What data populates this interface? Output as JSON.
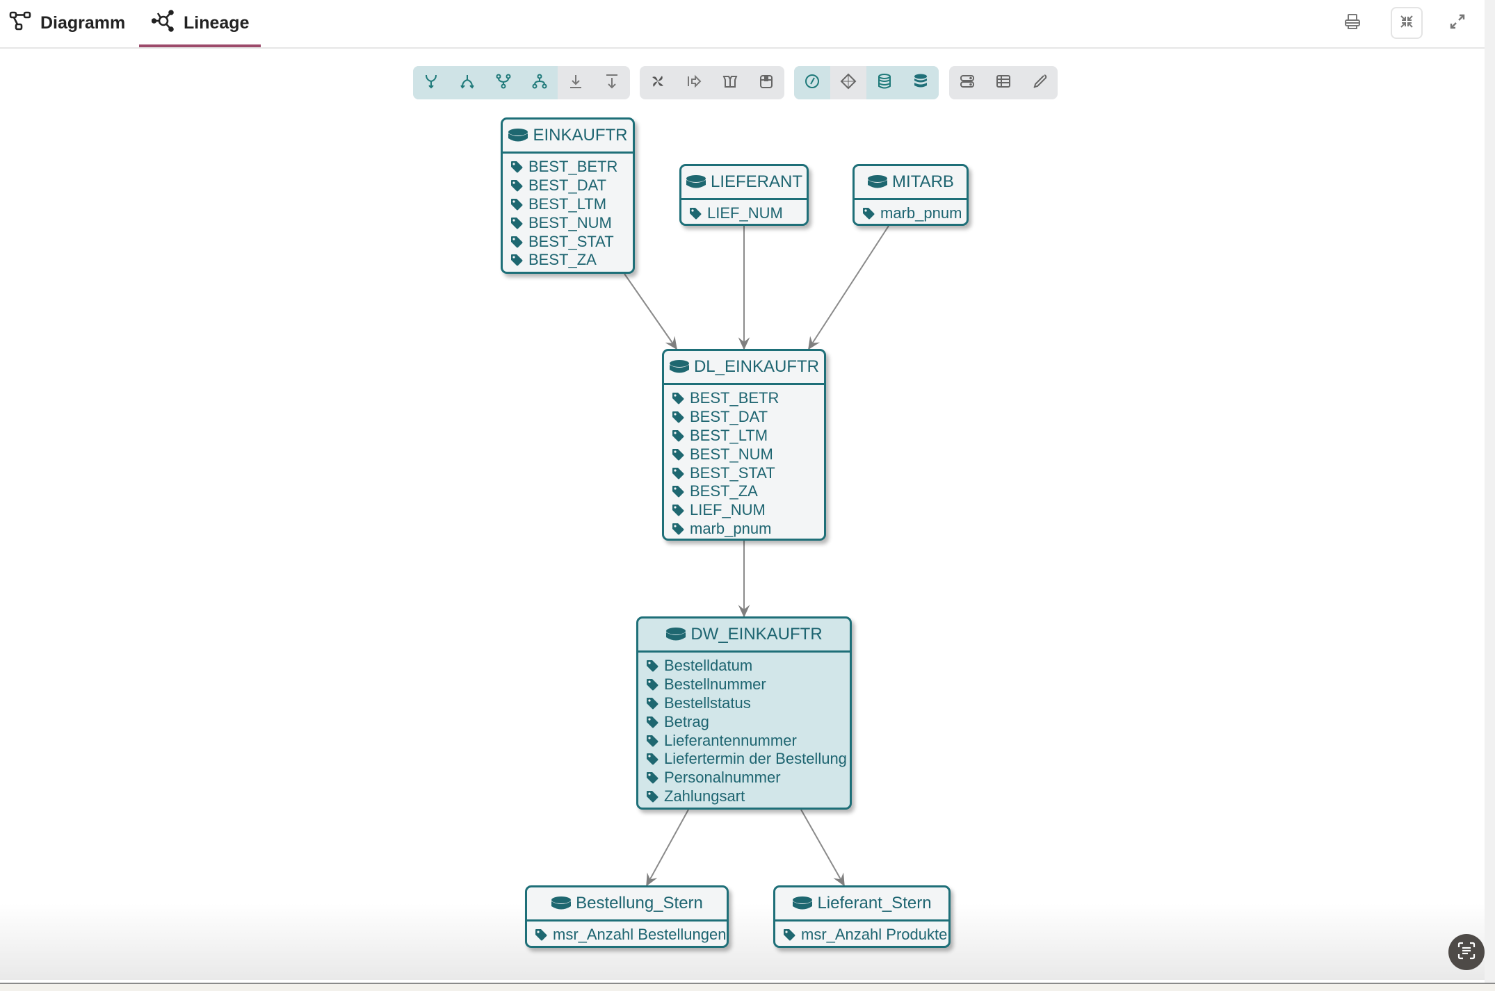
{
  "tabs": [
    {
      "label": "Diagramm",
      "icon": "diagram-icon",
      "active": false
    },
    {
      "label": "Lineage",
      "icon": "lineage-icon",
      "active": true
    }
  ],
  "header_actions": [
    {
      "icon": "print-icon",
      "label": "Print"
    },
    {
      "icon": "collapse-icon",
      "label": "Exit fullscreen"
    },
    {
      "icon": "expand-icon",
      "label": "Fullscreen"
    }
  ],
  "toolbar": {
    "groups": [
      {
        "items": [
          {
            "icon": "merge-down-icon",
            "active": true
          },
          {
            "icon": "split-down-icon",
            "active": true
          },
          {
            "icon": "fork-icon",
            "active": true
          },
          {
            "icon": "hierarchy-icon",
            "active": true
          },
          {
            "icon": "download-to-line-icon",
            "active": false
          },
          {
            "icon": "download-from-line-icon",
            "active": false
          }
        ]
      },
      {
        "items": [
          {
            "icon": "pinwheel-icon",
            "active": false
          },
          {
            "icon": "arrow-from-line-icon",
            "active": false
          },
          {
            "icon": "open-box-icon",
            "active": false
          },
          {
            "icon": "closed-box-icon",
            "active": false
          }
        ]
      },
      {
        "items": [
          {
            "icon": "gauge-icon",
            "active": true
          },
          {
            "icon": "diamond-icon",
            "active": false
          },
          {
            "icon": "database-outline-icon",
            "active": true
          },
          {
            "icon": "database-filled-icon",
            "active": true
          }
        ]
      },
      {
        "items": [
          {
            "icon": "server-icon",
            "active": false
          },
          {
            "icon": "table-icon",
            "active": false
          },
          {
            "icon": "pipette-icon",
            "active": false
          }
        ]
      }
    ]
  },
  "nodes": [
    {
      "id": "EINKAUFTR",
      "title": "EINKAUFTR",
      "fields": [
        "BEST_BETR",
        "BEST_DAT",
        "BEST_LTM",
        "BEST_NUM",
        "BEST_STAT",
        "BEST_ZA"
      ]
    },
    {
      "id": "LIEFERANT",
      "title": "LIEFERANT",
      "fields": [
        "LIEF_NUM"
      ]
    },
    {
      "id": "MITARB",
      "title": "MITARB",
      "fields": [
        "marb_pnum"
      ]
    },
    {
      "id": "DL_EINKAUFTR",
      "title": "DL_EINKAUFTR",
      "fields": [
        "BEST_BETR",
        "BEST_DAT",
        "BEST_LTM",
        "BEST_NUM",
        "BEST_STAT",
        "BEST_ZA",
        "LIEF_NUM",
        "marb_pnum"
      ]
    },
    {
      "id": "DW_EINKAUFTR",
      "title": "DW_EINKAUFTR",
      "selected": true,
      "fields": [
        "Bestelldatum",
        "Bestellnummer",
        "Bestellstatus",
        "Betrag",
        "Lieferantennummer",
        "Liefertermin der Bestellung",
        "Personalnummer",
        "Zahlungsart"
      ]
    },
    {
      "id": "Bestellung_Stern",
      "title": "Bestellung_Stern",
      "fields": [
        "msr_Anzahl Bestellungen"
      ]
    },
    {
      "id": "Lieferant_Stern",
      "title": "Lieferant_Stern",
      "fields": [
        "msr_Anzahl Produkte"
      ]
    }
  ],
  "edges": [
    {
      "from": "EINKAUFTR",
      "to": "DL_EINKAUFTR"
    },
    {
      "from": "LIEFERANT",
      "to": "DL_EINKAUFTR"
    },
    {
      "from": "MITARB",
      "to": "DL_EINKAUFTR"
    },
    {
      "from": "DL_EINKAUFTR",
      "to": "DW_EINKAUFTR"
    },
    {
      "from": "DW_EINKAUFTR",
      "to": "Bestellung_Stern"
    },
    {
      "from": "DW_EINKAUFTR",
      "to": "Lieferant_Stern"
    }
  ],
  "fab": {
    "icon": "scan-text-icon"
  }
}
